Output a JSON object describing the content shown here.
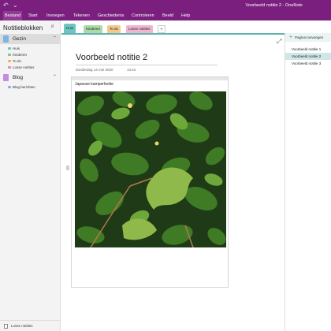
{
  "titlebar": {
    "title": "Voorbeeld notitie 2  -  OneNote",
    "back_icon": "undo-icon",
    "quick_icon": "chevron-down-icon"
  },
  "ribbon": {
    "tabs": [
      {
        "label": "Bestand",
        "active": true
      },
      {
        "label": "Start"
      },
      {
        "label": "Invoegen"
      },
      {
        "label": "Tekenen"
      },
      {
        "label": "Geschiedenis"
      },
      {
        "label": "Controleren"
      },
      {
        "label": "Beeld"
      },
      {
        "label": "Help"
      }
    ]
  },
  "sidebar": {
    "title": "Notitieblokken",
    "notebooks": [
      {
        "label": "Gezin",
        "color": "#7bb6e3",
        "sections": [
          {
            "label": "Huis",
            "color": "#6cc5c0"
          },
          {
            "label": "Kinderen",
            "color": "#7fc47f"
          },
          {
            "label": "To do",
            "color": "#f1b35a"
          },
          {
            "label": "Losse notities",
            "color": "#e58bb3"
          }
        ]
      },
      {
        "label": "Blog",
        "color": "#c58be3",
        "sections": [
          {
            "label": "Blog berichten",
            "color": "#7bb6e3"
          }
        ]
      }
    ],
    "bottom_label": "Losse notities"
  },
  "section_tabs": [
    {
      "label": "Huis",
      "color": "#6cc5c0",
      "active": true
    },
    {
      "label": "Kinderen",
      "color": "#a9dca9"
    },
    {
      "label": "To do",
      "color": "#f5c98a"
    },
    {
      "label": "Losse notities",
      "color": "#f1b5cf"
    }
  ],
  "page": {
    "title": "Voorbeeld notitie 2",
    "date": "donderdag 14 mei 2020",
    "time": "13:44",
    "note_caption": "Japanse kamperfoelie"
  },
  "pagelist": {
    "add_label": "Pagina toevoegen",
    "pages": [
      {
        "label": "Voorbeeld notitie 1"
      },
      {
        "label": "Voorbeeld notitie 2",
        "selected": true
      },
      {
        "label": "Voorbeeld notitie 3"
      }
    ]
  }
}
